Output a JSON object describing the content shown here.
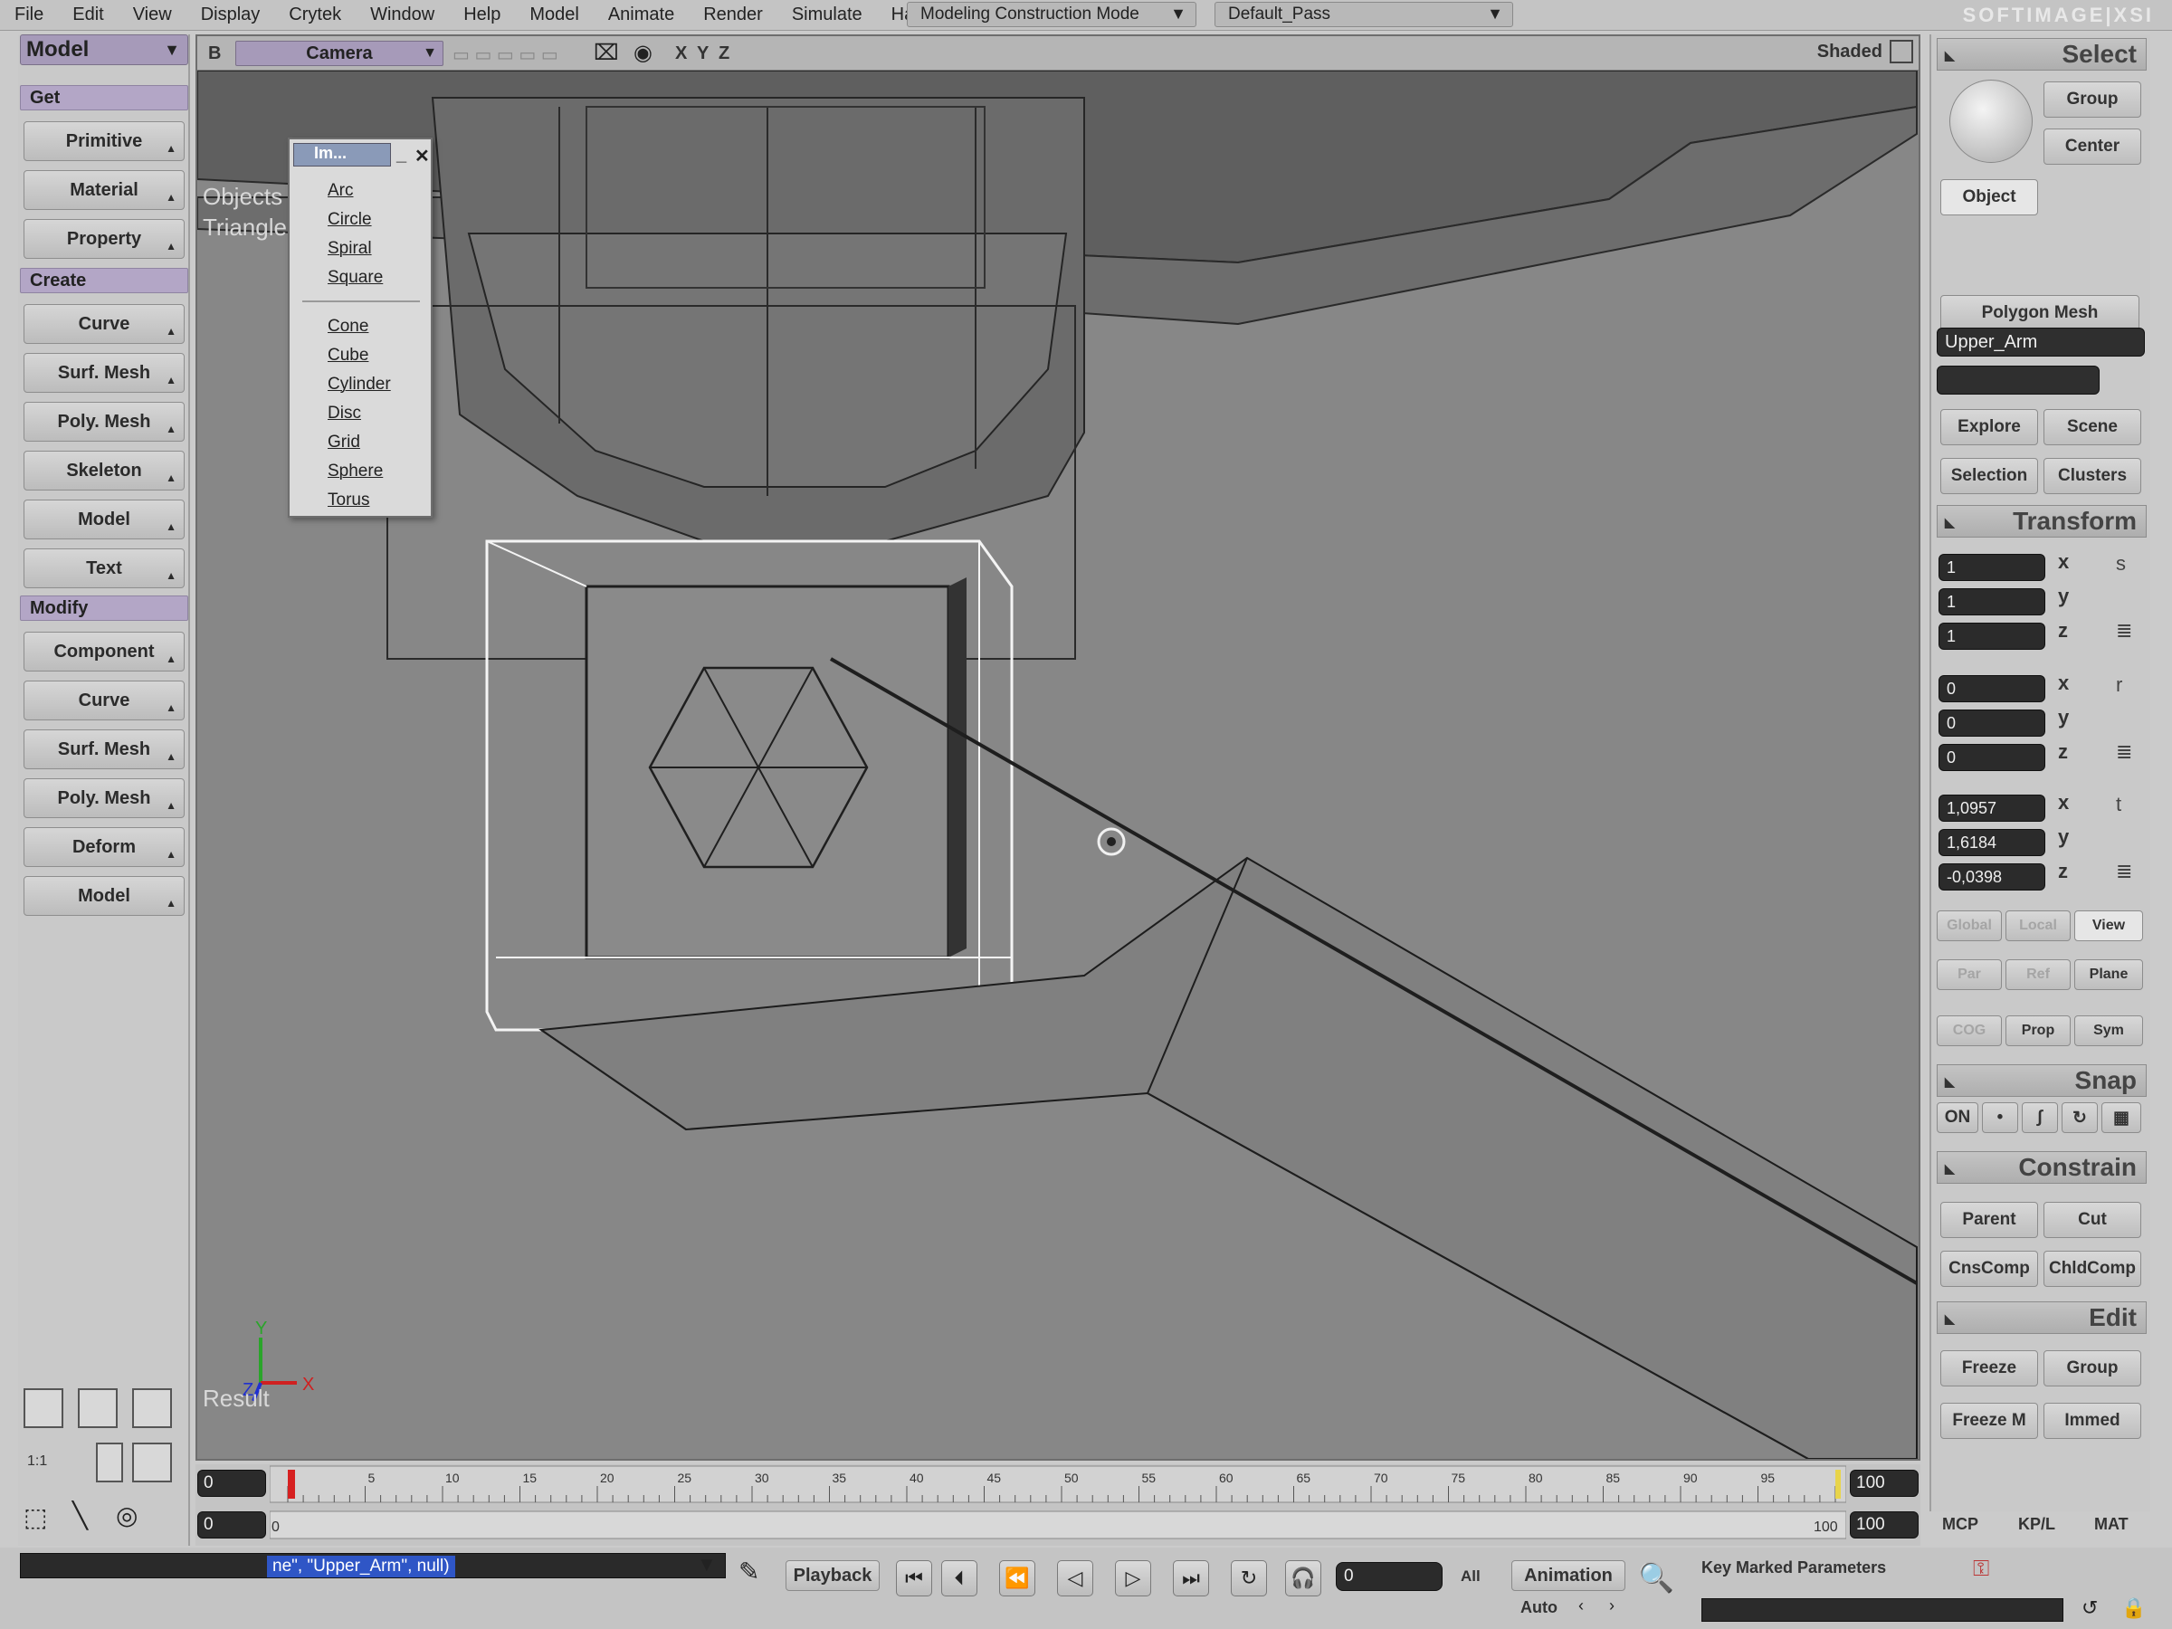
{
  "menubar": {
    "items": [
      "File",
      "Edit",
      "View",
      "Display",
      "Crytek",
      "Window",
      "Help",
      "Model",
      "Animate",
      "Render",
      "Simulate",
      "Hair"
    ],
    "mode_combo": "Modeling Construction Mode",
    "pass_combo": "Default_Pass",
    "brand": "SOFTIMAGE|XSI"
  },
  "left_panel": {
    "mode": "Model",
    "sections": {
      "get": {
        "title": "Get",
        "buttons": [
          "Primitive",
          "Material",
          "Property"
        ]
      },
      "create": {
        "title": "Create",
        "buttons": [
          "Curve",
          "Surf. Mesh",
          "Poly. Mesh",
          "Skeleton",
          "Model",
          "Text"
        ]
      },
      "modify": {
        "title": "Modify",
        "buttons": [
          "Component",
          "Curve",
          "Surf. Mesh",
          "Poly. Mesh",
          "Deform",
          "Model"
        ]
      }
    },
    "layout_label": "1:1"
  },
  "viewport": {
    "header_letter": "B",
    "camera": "Camera",
    "axis_toggles": [
      "X",
      "Y",
      "Z"
    ],
    "display_mode": "Shaded",
    "overlay_lines": [
      "Objects",
      "Triangle"
    ],
    "result_label": "Result",
    "axis_gizmo": {
      "y": "Y",
      "z": "Z",
      "x": "X"
    }
  },
  "popup": {
    "title": "Im...",
    "group1": [
      "Arc",
      "Circle",
      "Spiral",
      "Square"
    ],
    "group2": [
      "Cone",
      "Cube",
      "Cylinder",
      "Disc",
      "Grid",
      "Sphere",
      "Torus"
    ]
  },
  "right_panel": {
    "select": {
      "title": "Select",
      "group": "Group",
      "center": "Center",
      "object": "Object",
      "type": "Polygon Mesh",
      "name": "Upper_Arm",
      "explore": "Explore",
      "scene": "Scene",
      "selection": "Selection",
      "clusters": "Clusters"
    },
    "transform": {
      "title": "Transform",
      "scale": {
        "values": [
          "1",
          "1",
          "1"
        ],
        "icon": "s"
      },
      "rotate": {
        "values": [
          "0",
          "0",
          "0"
        ],
        "icon": "r"
      },
      "translate": {
        "values": [
          "1,0957",
          "1,6184",
          "-0,0398"
        ],
        "icon": "t"
      },
      "axes": [
        "x",
        "y",
        "z"
      ],
      "ref_modes": [
        "Global",
        "Local",
        "View",
        "Par",
        "Ref",
        "Plane",
        "COG",
        "Prop",
        "Sym"
      ]
    },
    "snap": {
      "title": "Snap",
      "on": "ON"
    },
    "constrain": {
      "title": "Constrain",
      "buttons": [
        "Parent",
        "Cut",
        "CnsComp",
        "ChldComp"
      ]
    },
    "edit": {
      "title": "Edit",
      "buttons": [
        "Freeze",
        "Group",
        "Freeze M",
        "Immed"
      ]
    },
    "tabs": [
      "MCP",
      "KP/L",
      "MAT"
    ]
  },
  "timeline": {
    "start": "0",
    "end": "100",
    "range_start": "0",
    "range_end": "100",
    "range_marker_start": "0",
    "range_marker_end": "100",
    "ticks": [
      "5",
      "10",
      "15",
      "20",
      "25",
      "30",
      "35",
      "40",
      "45",
      "50",
      "55",
      "60",
      "65",
      "70",
      "75",
      "80",
      "85",
      "90",
      "95"
    ]
  },
  "bottom": {
    "command": "ne\", \"Upper_Arm\", null)",
    "playback": "Playback",
    "current_frame": "0",
    "all": "All",
    "animation": "Animation",
    "auto": "Auto",
    "key_marked": "Key Marked Parameters"
  },
  "colors": {
    "accent_purple": "#a69ab9",
    "viewport_bg": "#878787",
    "field_bg": "#2b2b2b",
    "selection_blue": "#2f56c6",
    "timeline_marker": "#d62020"
  }
}
